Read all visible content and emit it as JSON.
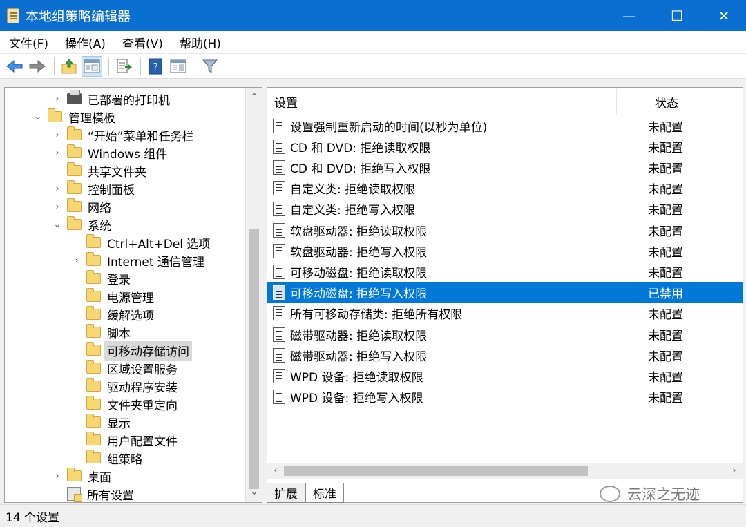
{
  "window": {
    "title": "本地组策略编辑器",
    "minimize": "—",
    "maximize": "☐",
    "close": "✕"
  },
  "menu": [
    "文件(F)",
    "操作(A)",
    "查看(V)",
    "帮助(H)"
  ],
  "tree": [
    {
      "label": "已部署的打印机",
      "expander": "›",
      "icon": "printer-icon"
    },
    {
      "label": "管理模板",
      "expander": "⌄",
      "icon": "folder-icon"
    },
    {
      "label": "“开始”菜单和任务栏",
      "expander": "›",
      "icon": "folder-icon"
    },
    {
      "label": "Windows 组件",
      "expander": "›",
      "icon": "folder-icon"
    },
    {
      "label": "共享文件夹",
      "expander": "",
      "icon": "folder-icon"
    },
    {
      "label": "控制面板",
      "expander": "›",
      "icon": "folder-icon"
    },
    {
      "label": "网络",
      "expander": "›",
      "icon": "folder-icon"
    },
    {
      "label": "系统",
      "expander": "⌄",
      "icon": "folder-icon"
    },
    {
      "label": "Ctrl+Alt+Del 选项",
      "expander": "",
      "icon": "folder-icon"
    },
    {
      "label": "Internet 通信管理",
      "expander": "›",
      "icon": "folder-icon"
    },
    {
      "label": "登录",
      "expander": "",
      "icon": "folder-icon"
    },
    {
      "label": "电源管理",
      "expander": "",
      "icon": "folder-icon"
    },
    {
      "label": "缓解选项",
      "expander": "",
      "icon": "folder-icon"
    },
    {
      "label": "脚本",
      "expander": "",
      "icon": "folder-icon"
    },
    {
      "label": "可移动存储访问",
      "expander": "",
      "icon": "folder-icon",
      "selected": true
    },
    {
      "label": "区域设置服务",
      "expander": "",
      "icon": "folder-icon"
    },
    {
      "label": "驱动程序安装",
      "expander": "",
      "icon": "folder-icon"
    },
    {
      "label": "文件夹重定向",
      "expander": "",
      "icon": "folder-icon"
    },
    {
      "label": "显示",
      "expander": "",
      "icon": "folder-icon"
    },
    {
      "label": "用户配置文件",
      "expander": "",
      "icon": "folder-icon"
    },
    {
      "label": "组策略",
      "expander": "",
      "icon": "folder-icon"
    },
    {
      "label": "桌面",
      "expander": "›",
      "icon": "folder-icon"
    },
    {
      "label": "所有设置",
      "expander": "",
      "icon": "settings-icon"
    }
  ],
  "list": {
    "columns": {
      "setting": "设置",
      "state": "状态"
    },
    "rows": [
      {
        "name": "设置强制重新启动的时间(以秒为单位)",
        "state": "未配置"
      },
      {
        "name": "CD 和 DVD: 拒绝读取权限",
        "state": "未配置"
      },
      {
        "name": "CD 和 DVD: 拒绝写入权限",
        "state": "未配置"
      },
      {
        "name": "自定义类: 拒绝读取权限",
        "state": "未配置"
      },
      {
        "name": "自定义类: 拒绝写入权限",
        "state": "未配置"
      },
      {
        "name": "软盘驱动器: 拒绝读取权限",
        "state": "未配置"
      },
      {
        "name": "软盘驱动器: 拒绝写入权限",
        "state": "未配置"
      },
      {
        "name": "可移动磁盘: 拒绝读取权限",
        "state": "未配置"
      },
      {
        "name": "可移动磁盘: 拒绝写入权限",
        "state": "已禁用",
        "selected": true
      },
      {
        "name": "所有可移动存储类: 拒绝所有权限",
        "state": "未配置"
      },
      {
        "name": "磁带驱动器: 拒绝读取权限",
        "state": "未配置"
      },
      {
        "name": "磁带驱动器: 拒绝写入权限",
        "state": "未配置"
      },
      {
        "name": "WPD 设备: 拒绝读取权限",
        "state": "未配置"
      },
      {
        "name": "WPD 设备: 拒绝写入权限",
        "state": "未配置"
      }
    ]
  },
  "tabs": [
    "扩展",
    "标准"
  ],
  "watermark": "云深之无迹",
  "status": "14 个设置"
}
